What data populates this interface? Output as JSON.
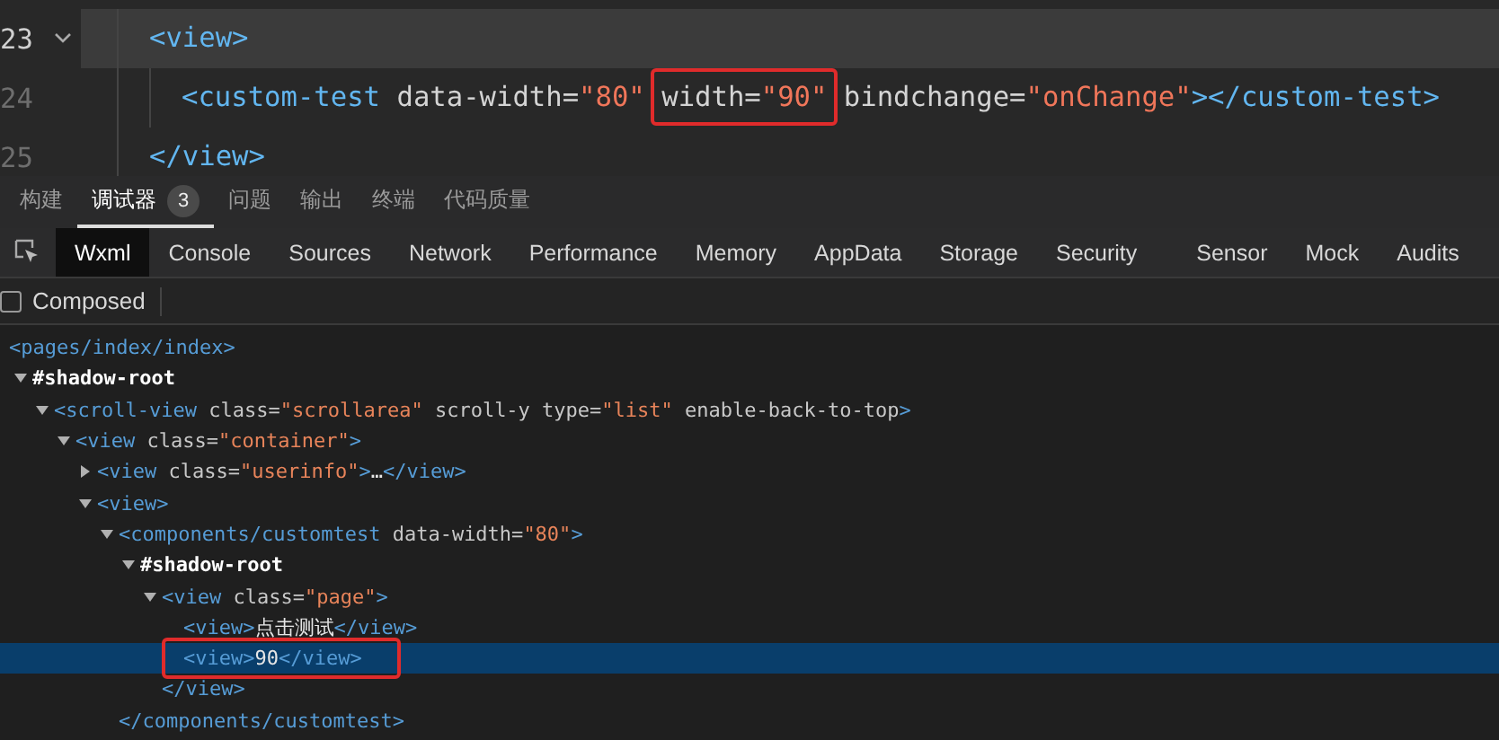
{
  "editor": {
    "lines": [
      {
        "number": "23",
        "current": true,
        "foldable": true,
        "tokens": [
          {
            "kind": "tag",
            "text": "<view>"
          }
        ],
        "children": [
          {
            "number": "24",
            "current": false,
            "foldable": false,
            "tokens": [
              {
                "kind": "tag",
                "text": "<custom-test "
              },
              {
                "kind": "attr",
                "text": "data-width="
              },
              {
                "kind": "value",
                "text": "\"80\" "
              },
              {
                "kind": "attr",
                "text": "width=",
                "highlighted": true
              },
              {
                "kind": "value",
                "text": "\"90\"",
                "highlighted": true
              },
              {
                "kind": "attr",
                "text": " bindchange="
              },
              {
                "kind": "value",
                "text": "\"onChange\""
              },
              {
                "kind": "tag",
                "text": "></custom-test>"
              }
            ]
          }
        ]
      },
      {
        "number": "25",
        "current": false,
        "foldable": false,
        "tokens": [
          {
            "kind": "tag",
            "text": "</view>"
          }
        ]
      }
    ]
  },
  "panel_tabs": [
    {
      "label": "构建",
      "selected": false
    },
    {
      "label": "调试器",
      "selected": true,
      "badge": "3"
    },
    {
      "label": "问题",
      "selected": false
    },
    {
      "label": "输出",
      "selected": false
    },
    {
      "label": "终端",
      "selected": false
    },
    {
      "label": "代码质量",
      "selected": false
    }
  ],
  "devtools_tabs": [
    {
      "label": "Wxml",
      "selected": true
    },
    {
      "label": "Console",
      "selected": false
    },
    {
      "label": "Sources",
      "selected": false
    },
    {
      "label": "Network",
      "selected": false
    },
    {
      "label": "Performance",
      "selected": false
    },
    {
      "label": "Memory",
      "selected": false
    },
    {
      "label": "AppData",
      "selected": false
    },
    {
      "label": "Storage",
      "selected": false
    },
    {
      "label": "Security",
      "selected": false
    },
    {
      "label": "Sensor",
      "selected": false
    },
    {
      "label": "Mock",
      "selected": false
    },
    {
      "label": "Audits",
      "selected": false
    }
  ],
  "composed": {
    "label": "Composed",
    "checked": false
  },
  "tree": [
    {
      "tokens": [
        {
          "kind": "tag",
          "text": "<pages/index/index>"
        }
      ],
      "selected": false,
      "children": [
        {
          "tokens": [
            {
              "kind": "root",
              "text": "#shadow-root"
            }
          ],
          "expanded": true,
          "selected": false,
          "children": [
            {
              "tokens": [
                {
                  "kind": "tag",
                  "text": "<scroll-view "
                },
                {
                  "kind": "attr",
                  "text": "class="
                },
                {
                  "kind": "value",
                  "text": "\"scrollarea\""
                },
                {
                  "kind": "attr",
                  "text": " scroll-y type="
                },
                {
                  "kind": "value",
                  "text": "\"list\""
                },
                {
                  "kind": "attr",
                  "text": " enable-back-to-top"
                },
                {
                  "kind": "tag",
                  "text": ">"
                }
              ],
              "expanded": true,
              "selected": false,
              "children": [
                {
                  "tokens": [
                    {
                      "kind": "tag",
                      "text": "<view "
                    },
                    {
                      "kind": "attr",
                      "text": "class="
                    },
                    {
                      "kind": "value",
                      "text": "\"container\""
                    },
                    {
                      "kind": "tag",
                      "text": ">"
                    }
                  ],
                  "expanded": true,
                  "selected": false,
                  "children": [
                    {
                      "tokens": [
                        {
                          "kind": "tag",
                          "text": "<view "
                        },
                        {
                          "kind": "attr",
                          "text": "class="
                        },
                        {
                          "kind": "value",
                          "text": "\"userinfo\""
                        },
                        {
                          "kind": "tag",
                          "text": ">"
                        },
                        {
                          "kind": "text",
                          "text": "…"
                        },
                        {
                          "kind": "tag",
                          "text": "</view>"
                        }
                      ],
                      "expanded": false,
                      "selected": false
                    },
                    {
                      "tokens": [
                        {
                          "kind": "tag",
                          "text": "<view>"
                        }
                      ],
                      "expanded": true,
                      "selected": false,
                      "children": [
                        {
                          "tokens": [
                            {
                              "kind": "tag",
                              "text": "<components/customtest "
                            },
                            {
                              "kind": "attr",
                              "text": "data-width="
                            },
                            {
                              "kind": "value",
                              "text": "\"80\""
                            },
                            {
                              "kind": "tag",
                              "text": ">"
                            }
                          ],
                          "expanded": true,
                          "selected": false,
                          "closing": "</components/customtest>",
                          "children": [
                            {
                              "tokens": [
                                {
                                  "kind": "root",
                                  "text": "#shadow-root"
                                }
                              ],
                              "expanded": true,
                              "selected": false,
                              "children": [
                                {
                                  "tokens": [
                                    {
                                      "kind": "tag",
                                      "text": "<view "
                                    },
                                    {
                                      "kind": "attr",
                                      "text": "class="
                                    },
                                    {
                                      "kind": "value",
                                      "text": "\"page\""
                                    },
                                    {
                                      "kind": "tag",
                                      "text": ">"
                                    }
                                  ],
                                  "expanded": true,
                                  "selected": false,
                                  "closing": "</view>",
                                  "children": [
                                    {
                                      "tokens": [
                                        {
                                          "kind": "tag",
                                          "text": "<view>"
                                        },
                                        {
                                          "kind": "text",
                                          "text": "点击测试"
                                        },
                                        {
                                          "kind": "tag",
                                          "text": "</view>"
                                        }
                                      ],
                                      "selected": false
                                    },
                                    {
                                      "tokens": [
                                        {
                                          "kind": "tag",
                                          "text": "<view>"
                                        },
                                        {
                                          "kind": "text",
                                          "text": "90"
                                        },
                                        {
                                          "kind": "tag",
                                          "text": "</view>"
                                        }
                                      ],
                                      "selected": true,
                                      "highlighted": true
                                    }
                                  ]
                                }
                              ]
                            }
                          ]
                        }
                      ]
                    }
                  ]
                }
              ]
            }
          ]
        }
      ]
    }
  ]
}
